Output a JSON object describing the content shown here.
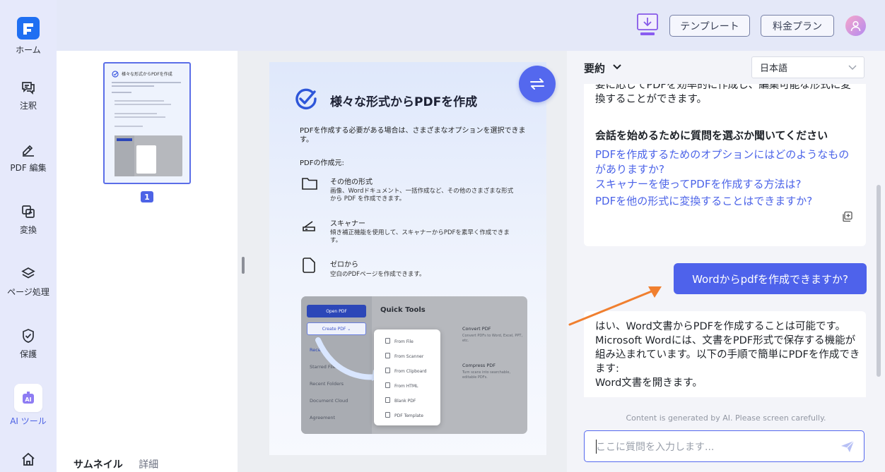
{
  "rail": {
    "items": [
      {
        "label": "ホーム"
      },
      {
        "label": "注釈"
      },
      {
        "label": "PDF 編集"
      },
      {
        "label": "変換"
      },
      {
        "label": "ページ処理"
      },
      {
        "label": "保護"
      },
      {
        "label": "AI ツール"
      }
    ],
    "active_color": "#4a5fe3"
  },
  "topbar": {
    "template_label": "テンプレート",
    "pricing_label": "料金プラン"
  },
  "thumbnails": {
    "page_number": "1",
    "tab_thumbnail": "サムネイル",
    "tab_detail": "詳細",
    "mini_title": "様々な形式からPDFを作成"
  },
  "document": {
    "title": "様々な形式からPDFを作成",
    "intro": "PDFを作成する必要がある場合は、さまざまなオプションを選択できます。",
    "source_heading": "PDFの作成元:",
    "options": [
      {
        "title": "その他の形式",
        "desc": "画像、Wordドキュメント、一括作成など、その他のさまざまな形式から PDF を作成できます。"
      },
      {
        "title": "スキャナー",
        "desc": "傾き補正機能を使用して、スキャナーからPDFを素早く作成できます。"
      },
      {
        "title": "ゼロから",
        "desc": "空白のPDFページを作成できます。"
      }
    ],
    "quick_tools": {
      "open_pdf": "Open PDF",
      "create_pdf": "Create PDF",
      "sidebar": [
        "Recent",
        "Starred Files",
        "Recent Folders",
        "Document Cloud",
        "Agreement"
      ],
      "title": "Quick Tools",
      "cards": [
        {
          "title": "Convert PDF",
          "sub": "Convert PDFs to Word, Excel, PPT, etc."
        },
        {
          "title": "Compress PDF",
          "sub": "Turn scans into searchable, editable PDFs."
        }
      ],
      "dropdown": [
        "From File",
        "From Scanner",
        "From Clipboard",
        "From HTML",
        "Blank PDF",
        "PDF Template"
      ]
    }
  },
  "chat": {
    "header_label": "要約",
    "language": "日本語",
    "assistant_intro": "要に応じてPDFを効率的に作成し、編集可能な形式に変換することができます。",
    "prompt_heading": "会話を始めるために質問を選ぶか聞いてください",
    "suggestions": [
      "PDFを作成するためのオプションにはどのようなものがありますか?",
      "スキャナーを使ってPDFを作成する方法は?",
      "PDFを他の形式に変換することはできますか?"
    ],
    "user_message": "Wordからpdfを作成できますか?",
    "assistant_reply": "はい、Word文書からPDFを作成することは可能です。Microsoft Wordには、文書をPDF形式で保存する機能が組み込まれています。以下の手順で簡単にPDFを作成できます:",
    "assistant_reply_line2": "Word文書を開きます。",
    "disclaimer": "Content is generated by AI. Please screen carefully.",
    "input_placeholder": "ここに質問を入力します..."
  },
  "colors": {
    "accent": "#4e62eb",
    "link": "#4b63e8",
    "annotation_arrow": "#f07f2f"
  }
}
